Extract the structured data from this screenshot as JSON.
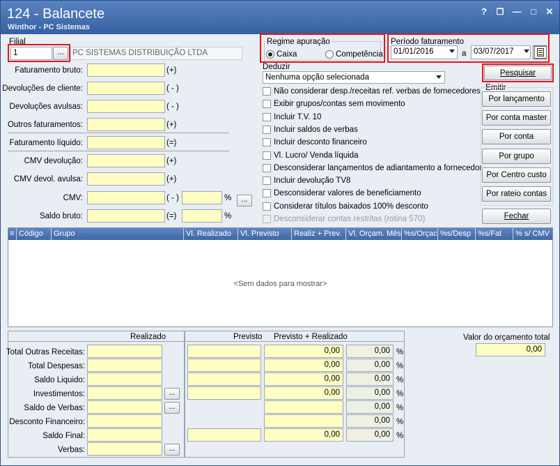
{
  "window": {
    "title": "124 - Balancete",
    "subtitle": "Winthor - PC Sistemas",
    "controls": [
      "?",
      "❐",
      "—",
      "□",
      "✕"
    ]
  },
  "filial": {
    "label": "Filial",
    "value": "1",
    "dots": "...",
    "company": "PC SISTEMAS DISTRIBUIÇÃO LTDA"
  },
  "left_fields": [
    {
      "label": "Faturamento bruto:",
      "sign": "(+)"
    },
    {
      "label": "Devoluções de cliente:",
      "sign": "( - )"
    },
    {
      "label": "Devoluções avulsas:",
      "sign": "( - )"
    },
    {
      "label": "Outros faturamentos:",
      "sign": "(+)"
    },
    {
      "label": "Faturamento líquido:",
      "sign": "(=)"
    },
    {
      "label": "CMV devolução:",
      "sign": "(+)"
    },
    {
      "label": "CMV devol. avulsa:",
      "sign": "(+)"
    },
    {
      "label": "CMV:",
      "sign": "( - )",
      "pct": "%"
    },
    {
      "label": "Saldo bruto:",
      "sign": "(=)",
      "pct": "%"
    }
  ],
  "regime": {
    "title": "Regime apuração",
    "options": [
      "Caixa",
      "Competência"
    ],
    "selected": "Caixa"
  },
  "periodo": {
    "title": "Período faturamento",
    "start": "01/01/2016",
    "sep": "a",
    "end": "03/07/2017"
  },
  "deduzir": {
    "label": "Deduzir",
    "selected": "Nenhuma opção selecionada"
  },
  "options": [
    {
      "label": "Não considerar desp./receitas ref. verbas de fornecedores",
      "checked": false,
      "enabled": true
    },
    {
      "label": "Exibir grupos/contas sem movimento",
      "checked": false,
      "enabled": true
    },
    {
      "label": "Incluir T.V. 10",
      "checked": false,
      "enabled": true
    },
    {
      "label": "Incluir saldos de verbas",
      "checked": false,
      "enabled": true
    },
    {
      "label": "Incluir desconto financeiro",
      "checked": false,
      "enabled": true
    },
    {
      "label": "Vl. Lucro/ Venda líquida",
      "checked": false,
      "enabled": true
    },
    {
      "label": "Desconsiderar lançamentos de adiantamento a fornecedor",
      "checked": false,
      "enabled": true
    },
    {
      "label": "Incluir devolução TV8",
      "checked": false,
      "enabled": true
    },
    {
      "label": "Desconsiderar valores de beneficiamento",
      "checked": false,
      "enabled": true
    },
    {
      "label": "Considerar títulos baixados 100% desconto",
      "checked": false,
      "enabled": true
    },
    {
      "label": "Desconsiderar contas restritas (rotina 570)",
      "checked": false,
      "enabled": false
    }
  ],
  "buttons": {
    "pesquisar": "Pesquisar",
    "emitir": "Emitir",
    "emitir_items": [
      "Por lançamento",
      "Por conta master",
      "Por conta",
      "Por grupo",
      "Por Centro custo",
      "Por rateio contas"
    ],
    "fechar": "Fechar"
  },
  "grid": {
    "columns": [
      "Código",
      "Grupo",
      "Vl. Realizado",
      "Vl. Previsto",
      "Realiz + Prev.",
      "Vl. Orçam. Mês",
      "%s/Orçac",
      "%s/Desp",
      "%s/Fat",
      "% s/ CMV"
    ],
    "empty": "<Sem dados para mostrar>"
  },
  "summary": {
    "head_realizado": "Realizado",
    "head_previsto": "Previsto",
    "head_prev_real": "Previsto + Realizado",
    "rows": [
      {
        "label": "Total Outras Receitas:",
        "previsto": "0,00",
        "prev_real": "0,00",
        "pct": "%"
      },
      {
        "label": "Total Despesas:",
        "previsto": "0,00",
        "prev_real": "0,00",
        "pct": "%"
      },
      {
        "label": "Saldo Liquido:",
        "previsto": "0,00",
        "prev_real": "0,00",
        "pct": "%"
      },
      {
        "label": "Investimentos:",
        "previsto": "0,00",
        "prev_real": "0,00",
        "pct": "%"
      },
      {
        "label": "Saldo de Verbas:",
        "previsto": "",
        "prev_real": "0,00",
        "pct": "%"
      },
      {
        "label": "Desconto Financeiro:",
        "previsto": "",
        "prev_real": "0,00",
        "pct": "%"
      },
      {
        "label": "Saldo Final:",
        "previsto": "0,00",
        "prev_real": "0,00",
        "pct": "%"
      },
      {
        "label": "Verbas:",
        "previsto": "",
        "prev_real": "",
        "pct": ""
      }
    ],
    "orcamento_label": "Valor do orçamento total",
    "orcamento_value": "0,00"
  }
}
